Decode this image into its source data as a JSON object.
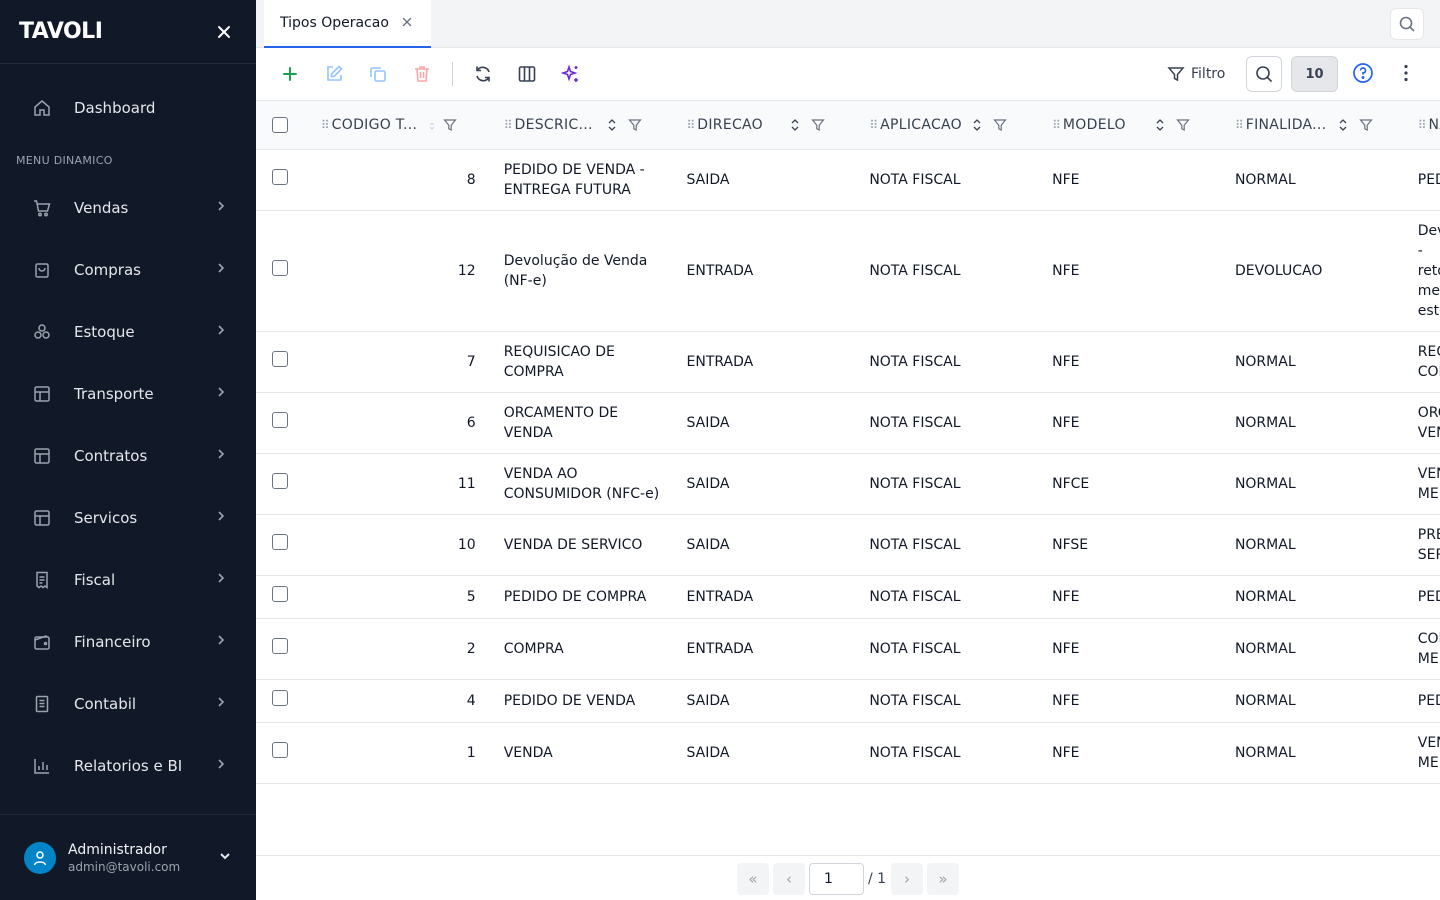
{
  "app": {
    "logo": "TAVOLI"
  },
  "sidebar": {
    "dashboard": "Dashboard",
    "menu_label": "MENU DINAMICO",
    "items": [
      {
        "label": "Vendas",
        "icon": "cart-icon"
      },
      {
        "label": "Compras",
        "icon": "bag-icon"
      },
      {
        "label": "Estoque",
        "icon": "boxes-icon"
      },
      {
        "label": "Transporte",
        "icon": "table-icon"
      },
      {
        "label": "Contratos",
        "icon": "table-icon"
      },
      {
        "label": "Servicos",
        "icon": "table-icon"
      },
      {
        "label": "Fiscal",
        "icon": "receipt-icon"
      },
      {
        "label": "Financeiro",
        "icon": "wallet-icon"
      },
      {
        "label": "Contabil",
        "icon": "ledger-icon"
      },
      {
        "label": "Relatorios e BI",
        "icon": "bar-chart-icon"
      }
    ],
    "user": {
      "name": "Administrador",
      "email": "admin@tavoli.com"
    }
  },
  "tabs": [
    {
      "label": "Tipos Operacao"
    }
  ],
  "toolbar": {
    "filter_label": "Filtro",
    "page_size": "10"
  },
  "table": {
    "columns": [
      "CODIGO T...",
      "DESCRIC...",
      "DIRECAO",
      "APLICACAO",
      "MODELO",
      "FINALIDA...",
      "NAT"
    ],
    "rows": [
      {
        "codigo": "8",
        "descricao": "PEDIDO DE VENDA - ENTREGA FUTURA",
        "direcao": "SAIDA",
        "aplicacao": "NOTA FISCAL",
        "modelo": "NFE",
        "finalidade": "NORMAL",
        "natureza": "PEDID"
      },
      {
        "codigo": "12",
        "descricao": "Devolução de Venda (NF-e)",
        "direcao": "ENTRADA",
        "aplicacao": "NOTA FISCAL",
        "modelo": "NFE",
        "finalidade": "DEVOLUCAO",
        "natureza": "Devol - retor merca estoq"
      },
      {
        "codigo": "7",
        "descricao": "REQUISICAO DE COMPRA",
        "direcao": "ENTRADA",
        "aplicacao": "NOTA FISCAL",
        "modelo": "NFE",
        "finalidade": "NORMAL",
        "natureza": "REQU COMP"
      },
      {
        "codigo": "6",
        "descricao": "ORCAMENTO DE VENDA",
        "direcao": "SAIDA",
        "aplicacao": "NOTA FISCAL",
        "modelo": "NFE",
        "finalidade": "NORMAL",
        "natureza": "ORCA VEND"
      },
      {
        "codigo": "11",
        "descricao": "VENDA AO CONSUMIDOR (NFC-e)",
        "direcao": "SAIDA",
        "aplicacao": "NOTA FISCAL",
        "modelo": "NFCE",
        "finalidade": "NORMAL",
        "natureza": "VEND MERC"
      },
      {
        "codigo": "10",
        "descricao": "VENDA DE SERVICO",
        "direcao": "SAIDA",
        "aplicacao": "NOTA FISCAL",
        "modelo": "NFSE",
        "finalidade": "NORMAL",
        "natureza": "PREST SERVI"
      },
      {
        "codigo": "5",
        "descricao": "PEDIDO DE COMPRA",
        "direcao": "ENTRADA",
        "aplicacao": "NOTA FISCAL",
        "modelo": "NFE",
        "finalidade": "NORMAL",
        "natureza": "PEDID"
      },
      {
        "codigo": "2",
        "descricao": "COMPRA",
        "direcao": "ENTRADA",
        "aplicacao": "NOTA FISCAL",
        "modelo": "NFE",
        "finalidade": "NORMAL",
        "natureza": "COMP MERC"
      },
      {
        "codigo": "4",
        "descricao": "PEDIDO DE VENDA",
        "direcao": "SAIDA",
        "aplicacao": "NOTA FISCAL",
        "modelo": "NFE",
        "finalidade": "NORMAL",
        "natureza": "PEDID"
      },
      {
        "codigo": "1",
        "descricao": "VENDA",
        "direcao": "SAIDA",
        "aplicacao": "NOTA FISCAL",
        "modelo": "NFE",
        "finalidade": "NORMAL",
        "natureza": "VEND MERC"
      }
    ]
  },
  "pagination": {
    "current": "1",
    "total": "/ 1",
    "first": "«",
    "prev": "‹",
    "next": "›",
    "last": "»"
  },
  "colors": {
    "sidebar_bg": "#111827",
    "accent": "#2563eb",
    "add_green": "#16a34a",
    "delete_red": "#ef4444",
    "ai_violet": "#6d28d9",
    "avatar_blue": "#0284c7"
  }
}
